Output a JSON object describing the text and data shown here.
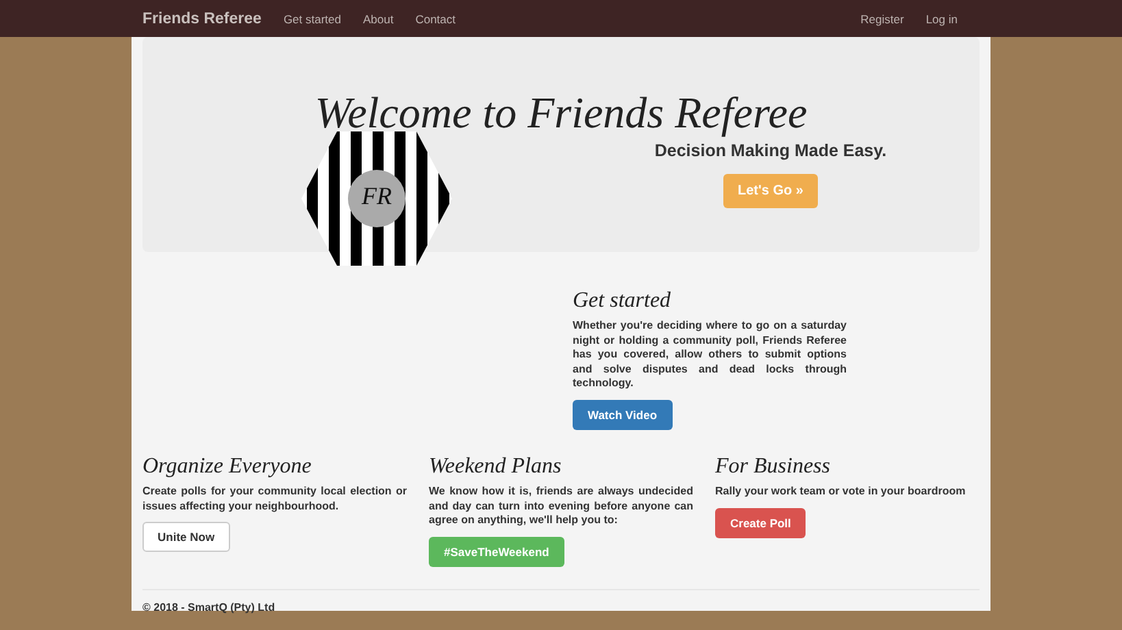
{
  "navbar": {
    "brand": "Friends Referee",
    "links": [
      "Get started",
      "About",
      "Contact"
    ],
    "right_links": [
      "Register",
      "Log in"
    ]
  },
  "hero": {
    "title": "Welcome to Friends Referee",
    "tagline": "Decision Making Made Easy.",
    "logo_text": "FR",
    "button": {
      "label": "Let's Go »",
      "kind": "warning"
    }
  },
  "intro": {
    "heading": "Get started",
    "text": "Whether you're deciding where to go on a saturday night or holding a community poll, Friends Referee has you covered, allow others to submit options and solve disputes and dead locks through technology.",
    "button": {
      "label": "Watch Video",
      "kind": "primary"
    }
  },
  "columns": [
    {
      "heading": "Organize Everyone",
      "text": "Create polls for your community local election or issues affecting your neighbourhood.",
      "button": {
        "label": "Unite Now",
        "kind": "default"
      }
    },
    {
      "heading": "Weekend Plans",
      "text": "We know how it is, friends are always undecided and day can turn into evening before anyone can agree on anything, we'll help you to:",
      "button": {
        "label": "#SaveTheWeekend",
        "kind": "success"
      }
    },
    {
      "heading": "For Business",
      "text": "Rally your work team or vote in your boardroom",
      "button": {
        "label": "Create Poll",
        "kind": "danger"
      }
    }
  ],
  "footer": "© 2018 - SmartQ (Pty) Ltd"
}
